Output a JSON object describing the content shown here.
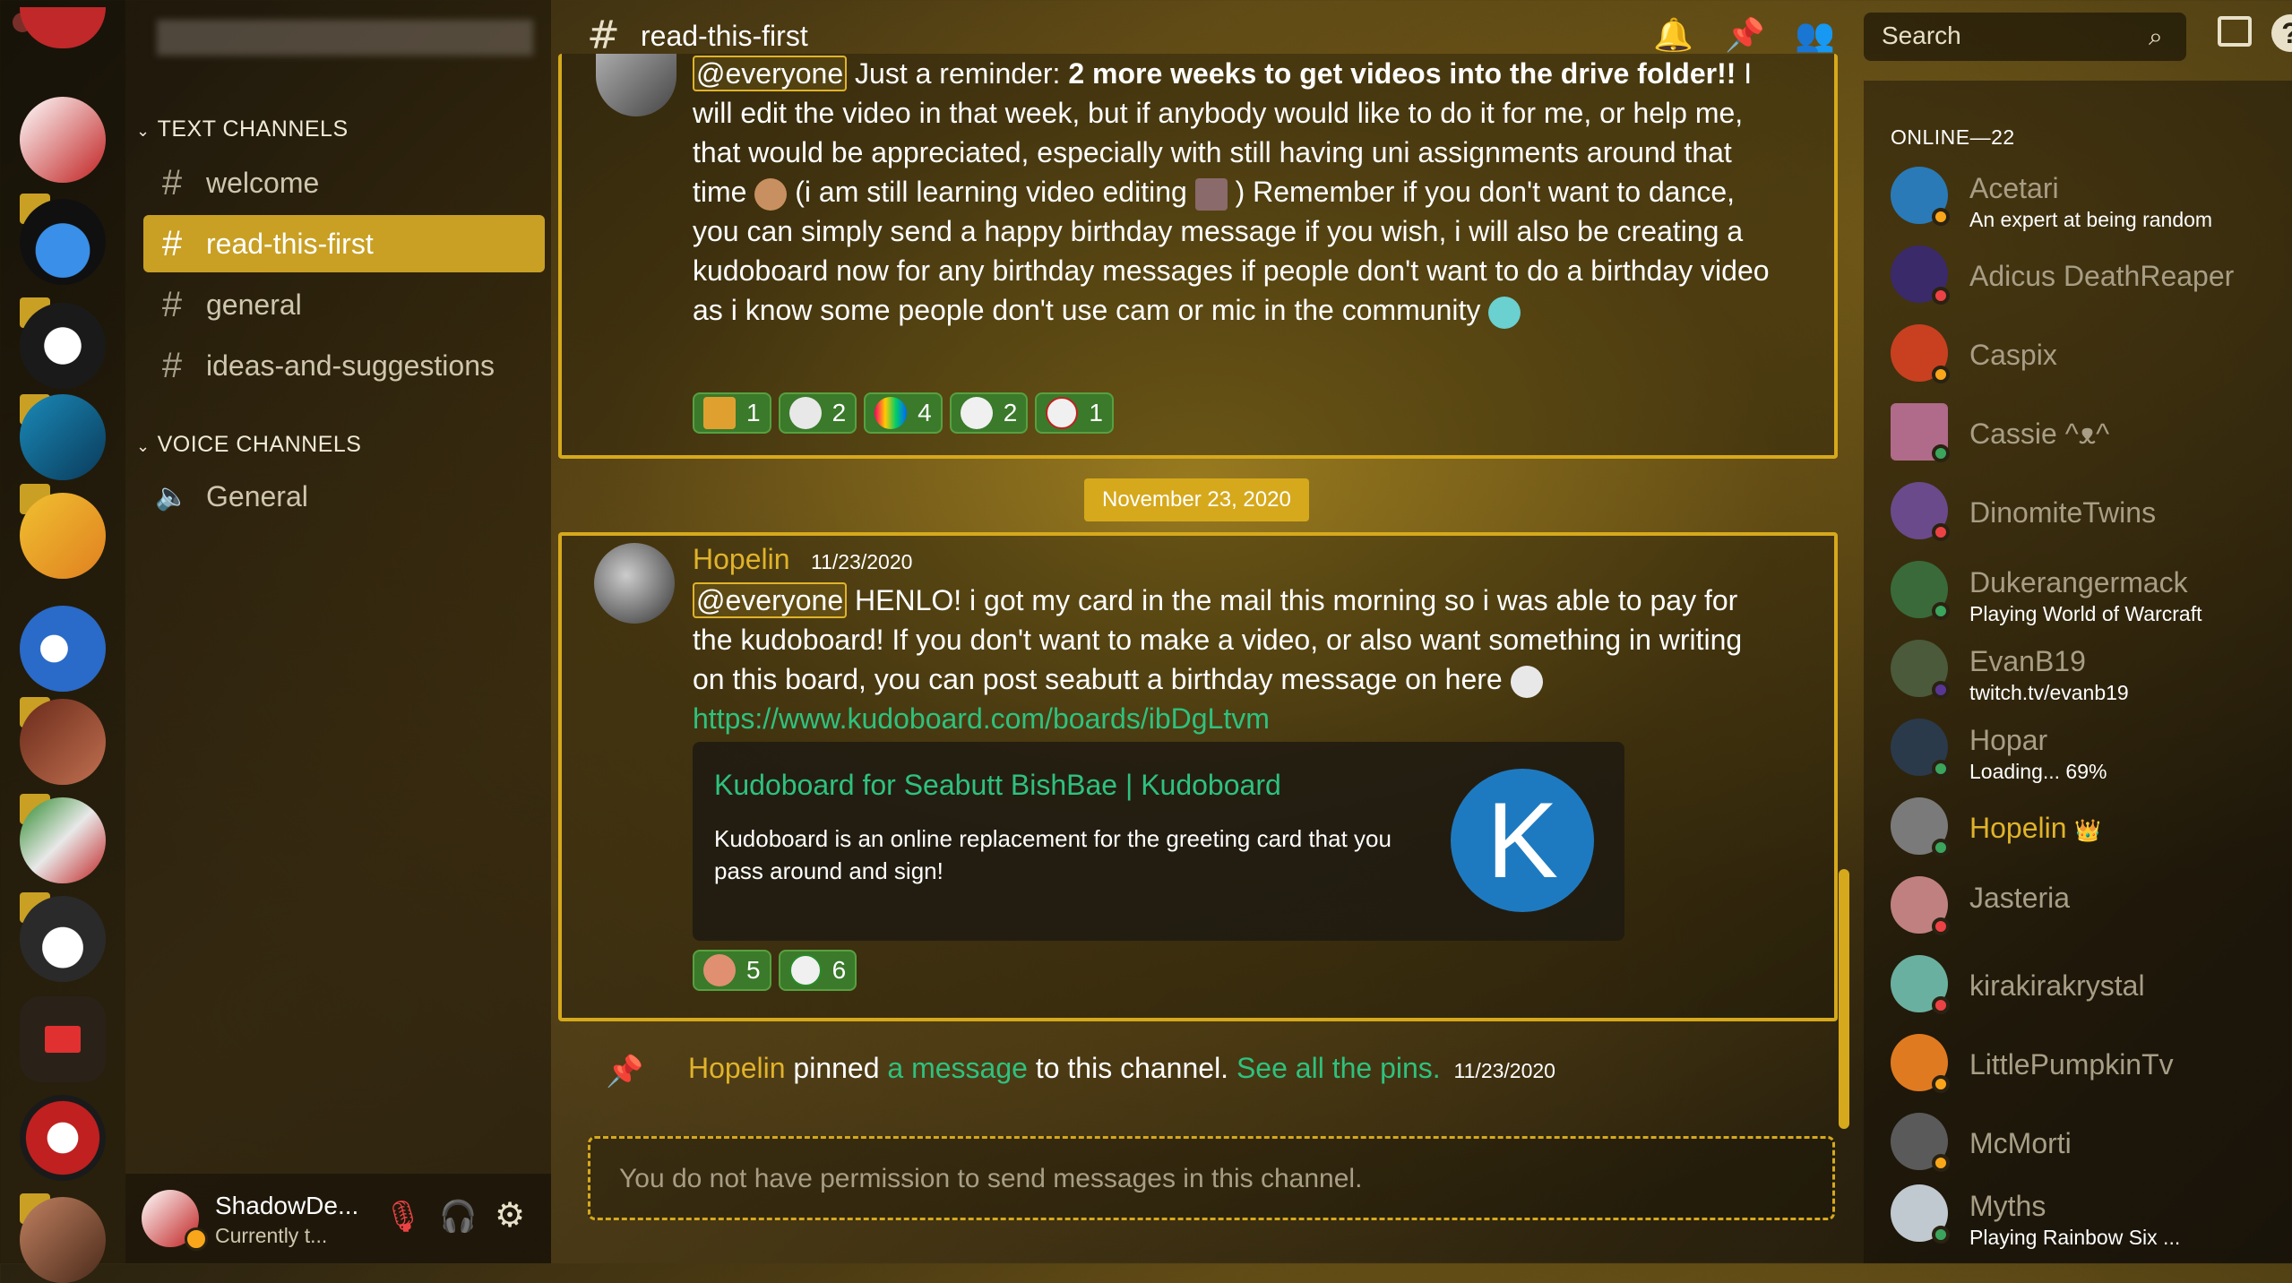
{
  "server": {
    "name": ""
  },
  "channel": {
    "title": "read-this-first"
  },
  "header": {
    "search_placeholder": "Search"
  },
  "sidebar": {
    "text_category": "TEXT CHANNELS",
    "voice_category": "VOICE CHANNELS",
    "text_channels": [
      {
        "label": "welcome",
        "active": false
      },
      {
        "label": "read-this-first",
        "active": true
      },
      {
        "label": "general",
        "active": false
      },
      {
        "label": "ideas-and-suggestions",
        "active": false
      }
    ],
    "voice_channels": [
      {
        "label": "General"
      }
    ]
  },
  "user_panel": {
    "username": "ShadowDe...",
    "status": "Currently t..."
  },
  "messages": {
    "first": {
      "mention": "@everyone",
      "text_a": " Just a reminder: ",
      "bold": "2 more weeks to get videos into the drive folder!!",
      "text_b": " I will edit the video in that week, but if anybody would like to do it for me, or help me, that would be appreciated, especially with still having uni assignments around that time ",
      "text_c": " (i am still learning video editing ",
      "text_d": " ) Remember if you don't want to dance, you can simply send a happy birthday message if you wish, i will also be creating a kudoboard now for any birthday messages if people don't want to do a birthday video as i know some people don't use cam or mic in the community ",
      "reactions": [
        "1",
        "2",
        "4",
        "2",
        "1"
      ]
    },
    "date_divider": "November 23, 2020",
    "second": {
      "author": "Hopelin",
      "timestamp": "11/23/2020",
      "mention": "@everyone",
      "text": " HENLO! i got my card in the mail this morning so i was able to pay for the kudoboard! If you don't want to make a video, or also want something in writing on this board, you can post seabutt a birthday message on here ",
      "link": "https://www.kudoboard.com/boards/ibDgLtvm",
      "embed_title": "Kudoboard for Seabutt BishBae | Kudoboard",
      "embed_desc": "Kudoboard is an online replacement for the greeting card that you pass around and sign!",
      "embed_logo_letter": "K",
      "reactions": [
        "5",
        "6"
      ]
    },
    "pin_notice": {
      "author": "Hopelin",
      "text_a": " pinned ",
      "link_a": "a message",
      "text_b": " to this channel. ",
      "link_b": "See all the pins.",
      "timestamp": "11/23/2020"
    }
  },
  "composer": {
    "placeholder": "You do not have permission to send messages in this channel."
  },
  "members": {
    "heading": "ONLINE—22",
    "list": [
      {
        "name": "Acetari",
        "status": "An expert at being random",
        "color": "#2a7ab8"
      },
      {
        "name": "Adicus DeathReaper",
        "status": "",
        "color": "#3a2a6a"
      },
      {
        "name": "Caspix",
        "status": "",
        "color": "#c84020"
      },
      {
        "name": "Cassie ^ᴥ^",
        "status": "",
        "color": "#b06a8a"
      },
      {
        "name": "DinomiteTwins",
        "status": "",
        "color": "#6a4a8a"
      },
      {
        "name": "Dukerangermack",
        "status": "Playing World of Warcraft",
        "color": "#3a6a3a"
      },
      {
        "name": "EvanB19",
        "status": "twitch.tv/evanb19",
        "color": "#4a5a3a"
      },
      {
        "name": "Hopar",
        "status": "Loading... 69%",
        "color": "#2a3a4a"
      },
      {
        "name": "Hopelin",
        "status": "",
        "color": "#7a7a7a"
      },
      {
        "name": "Jasteria",
        "status": "",
        "color": "#c08080"
      },
      {
        "name": "kirakirakrystal",
        "status": "",
        "color": "#6ab0a0"
      },
      {
        "name": "LittlePumpkinTv",
        "status": "",
        "color": "#e07a20"
      },
      {
        "name": "McMorti",
        "status": "",
        "color": "#5a5a5a"
      },
      {
        "name": "Myths",
        "status": "Playing Rainbow Six ...",
        "color": "#c0c8d0"
      }
    ]
  },
  "colors": {
    "accent": "#c9a024",
    "link": "#2ec27e",
    "online": "#3ba55d",
    "dnd": "#ed4245",
    "idle": "#faa61a"
  }
}
